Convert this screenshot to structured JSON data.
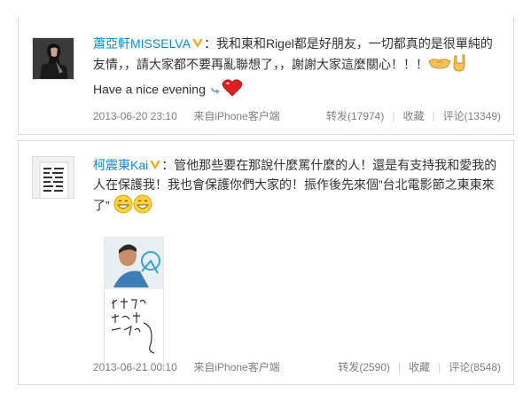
{
  "posts": [
    {
      "username": "蕭亞軒MISSELVA",
      "colon": "：",
      "text": "我和東和Rigel都是好朋友，一切都真的是很單純的友情，，請大家都不要再亂聯想了，，謝謝大家這麼關心！！！",
      "text_tail": "Have a nice evening",
      "timestamp": "2013-06-20 23:10",
      "source": "来自iPhone客户端",
      "repost": "转发(17974)",
      "favorite": "收藏",
      "comment": "评论(13349)"
    },
    {
      "username": "柯震東Kai",
      "colon": "：",
      "text": "管他那些要在那說什麼罵什麼的人！還是有支持我和愛我的人在保護我！我也會保護你們大家的！振作後先來個”台北電影節之東東來了”",
      "timestamp": "2013-06-21 00:10",
      "source": "来自iPhone客户端",
      "repost": "转发(2590)",
      "favorite": "收藏",
      "comment": "评论(8548)"
    }
  ],
  "colors": {
    "link": "#0a8cd2",
    "meta": "#808080",
    "badge": "#f5a623",
    "heart": "#e02020"
  },
  "icons": [
    "verified-badge-icon",
    "handshake-emoji-icon",
    "rock-hand-emoji-icon",
    "arrow-emoji-icon",
    "heart-emoji-icon",
    "grin-emoji-icon"
  ]
}
